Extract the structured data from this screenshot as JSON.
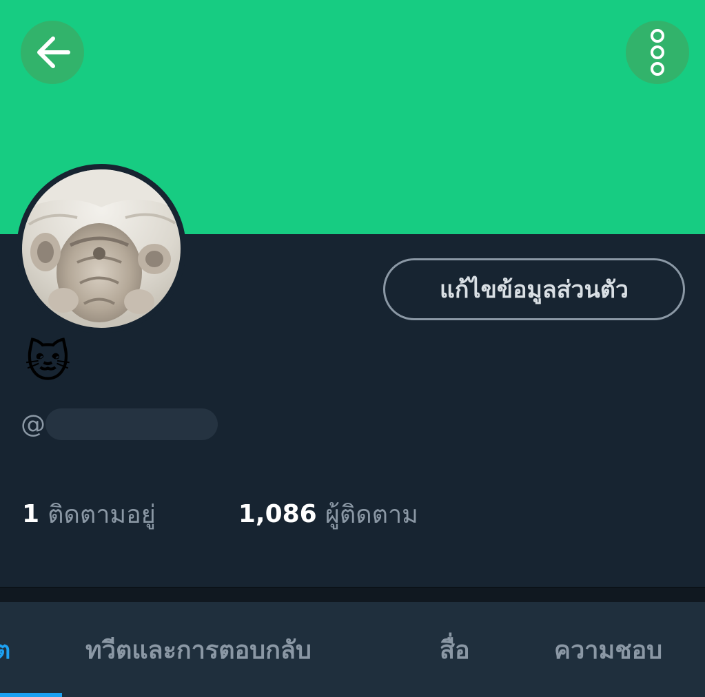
{
  "header": {
    "back_icon": "arrow-left-icon",
    "more_icon": "more-vertical-icon",
    "banner_color": "#17cc82"
  },
  "profile": {
    "avatar": "cat-photo-avatar",
    "edit_button_label": "แก้ไขข้อมูลส่วนตัว",
    "display_name": "🐱",
    "handle_prefix": "@"
  },
  "stats": {
    "following_count": "1",
    "following_label": "ติดตามอยู่",
    "followers_count": "1,086",
    "followers_label": "ผู้ติดตาม"
  },
  "tabs": {
    "active_label": "ต",
    "replies_label": "ทวีตและการตอบกลับ",
    "media_label": "สื่อ",
    "likes_label": "ความชอบ",
    "accent_color": "#1da1f2"
  }
}
